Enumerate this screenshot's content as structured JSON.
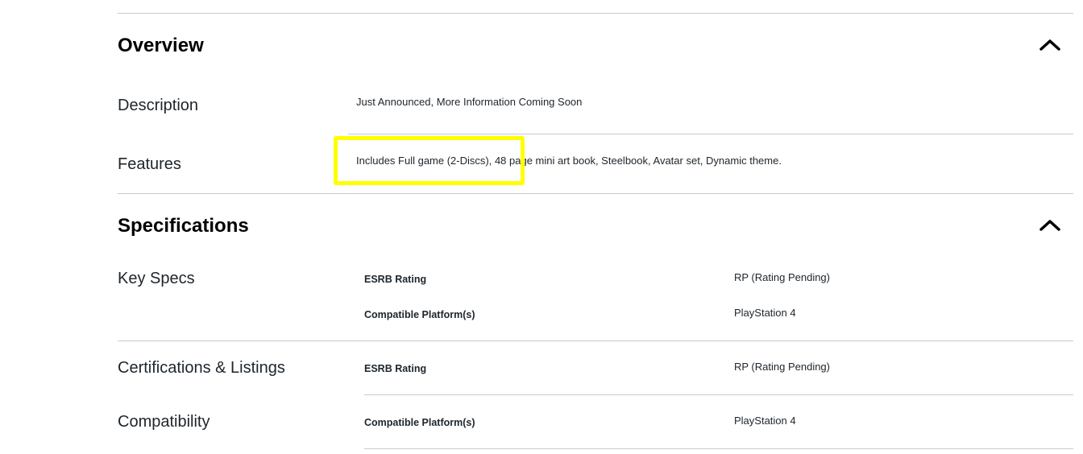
{
  "overview": {
    "title": "Overview",
    "toggle_icon": "chevron-up-icon",
    "rows": [
      {
        "label": "Description",
        "text": "Just Announced, More Information Coming Soon"
      },
      {
        "label": "Features",
        "text": "Includes Full game (2-Discs), 48 page mini art book, Steelbook, Avatar set, Dynamic theme."
      }
    ]
  },
  "specifications": {
    "title": "Specifications",
    "toggle_icon": "chevron-up-icon",
    "groups": [
      {
        "label": "Key Specs",
        "specs": [
          {
            "name": "ESRB Rating",
            "value": "RP (Rating Pending)"
          },
          {
            "name": "Compatible Platform(s)",
            "value": "PlayStation 4"
          }
        ]
      },
      {
        "label": "Certifications & Listings",
        "specs": [
          {
            "name": "ESRB Rating",
            "value": "RP (Rating Pending)"
          }
        ]
      },
      {
        "label": "Compatibility",
        "specs": [
          {
            "name": "Compatible Platform(s)",
            "value": "PlayStation 4"
          }
        ]
      }
    ]
  },
  "colors": {
    "highlight": "#ffff00",
    "divider": "#c5cbd5",
    "text": "#1d252c"
  }
}
